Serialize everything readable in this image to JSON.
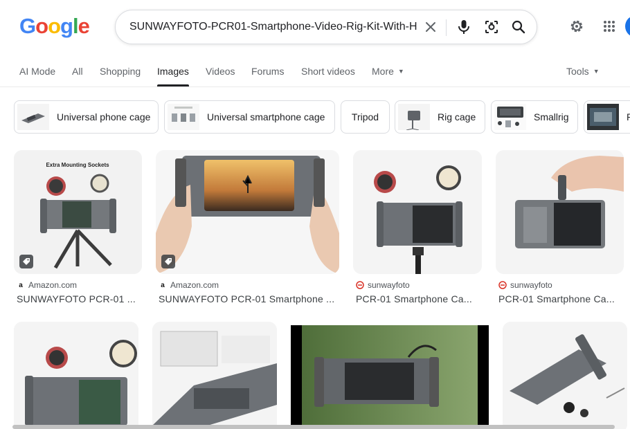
{
  "logo": {
    "letters": [
      "G",
      "o",
      "o",
      "g",
      "l",
      "e"
    ],
    "colors": [
      "#4285F4",
      "#EA4335",
      "#FBBC05",
      "#4285F4",
      "#34A853",
      "#EA4335"
    ]
  },
  "search": {
    "query": "SUNWAYFOTO-PCR01-Smartphone-Video-Rig-Kit-With-H"
  },
  "tabs": [
    {
      "label": "AI Mode"
    },
    {
      "label": "All"
    },
    {
      "label": "Shopping"
    },
    {
      "label": "Images"
    },
    {
      "label": "Videos"
    },
    {
      "label": "Forums"
    },
    {
      "label": "Short videos"
    },
    {
      "label": "More"
    },
    {
      "label": "Tools"
    }
  ],
  "chips": [
    {
      "label": "Universal phone cage"
    },
    {
      "label": "Universal smartphone cage"
    },
    {
      "label": "Tripod"
    },
    {
      "label": "Rig cage"
    },
    {
      "label": "Smallrig"
    },
    {
      "label": "P"
    }
  ],
  "results": [
    {
      "source": "Amazon.com",
      "title": "SUNWAYFOTO PCR-01 ...",
      "image_text": "Extra Mounting Sockets",
      "icon": "amazon-favicon"
    },
    {
      "source": "Amazon.com",
      "title": "SUNWAYFOTO PCR-01 Smartphone ...",
      "icon": "amazon-favicon"
    },
    {
      "source": "sunwayfoto",
      "title": "PCR-01 Smartphone Ca...",
      "icon": "sunwayfoto-favicon"
    },
    {
      "source": "sunwayfoto",
      "title": "PCR-01 Smartphone Ca...",
      "icon": "sunwayfoto-favicon"
    }
  ],
  "colors": {
    "accent": "#1a73e8",
    "text": "#202124",
    "muted": "#5f6368",
    "border": "#dadce0"
  }
}
